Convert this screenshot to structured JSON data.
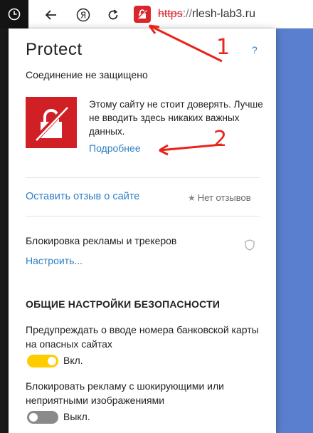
{
  "colors": {
    "accent": "#2f7fc6",
    "danger": "#d9262c",
    "toggle_on": "#ffcc00",
    "toggle_off": "#8a8a8a",
    "annotation": "#e8241c"
  },
  "toolbar": {
    "clock_icon": "clock-icon",
    "back_icon": "arrow-left-icon",
    "yandex_icon": "yandex-logo-icon",
    "reload_icon": "reload-icon",
    "lock_icon": "broken-lock-icon",
    "url_protocol": "https",
    "url_separator": "://",
    "url_host": "rlesh-lab3.ru"
  },
  "panel": {
    "title": "Protect",
    "help": "?",
    "connection_status": "Соединение не защищено",
    "warning_text": "Этому сайту не стоит доверять. Лучше не вводить здесь никаких важных данных.",
    "details_link": "Подробнее",
    "feedback_link": "Оставить отзыв о сайте",
    "reviews_icon": "star-icon",
    "reviews": "Нет отзывов",
    "adblock_label": "Блокировка рекламы и трекеров",
    "configure_link": "Настроить...",
    "section_title": "ОБЩИЕ НАСТРОЙКИ БЕЗОПАСНОСТИ",
    "options": [
      {
        "label": "Предупреждать о вводе номера банковской карты на опасных сайтах",
        "state": "Вкл.",
        "on": true
      },
      {
        "label": "Блокировать рекламу с шокирующими или неприятными изображениями",
        "state": "Выкл.",
        "on": false
      }
    ]
  },
  "annotations": [
    "1",
    "2"
  ]
}
